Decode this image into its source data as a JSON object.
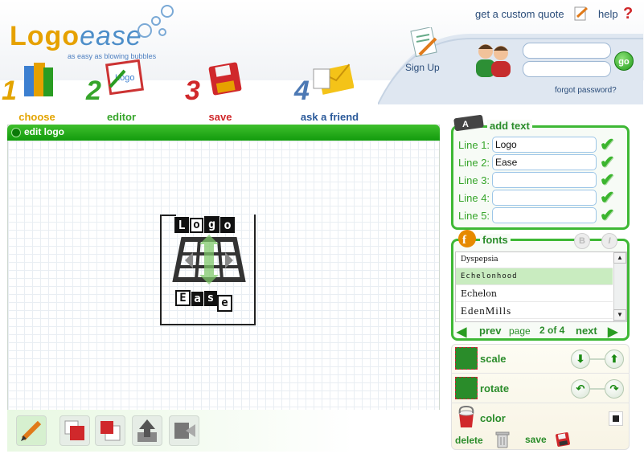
{
  "brand": {
    "logo_part1": "Logo",
    "logo_part2": "ease",
    "tagline": "as easy as blowing bubbles"
  },
  "top_links": {
    "custom_quote": "get a custom quote",
    "help": "help",
    "help_icon": "?"
  },
  "account": {
    "signup_label": "Sign Up",
    "username_value": "",
    "password_value": "",
    "go_label": "go",
    "forgot_label": "forgot password?"
  },
  "steps": [
    {
      "number": "1",
      "label": "choose",
      "icon": "books-icon"
    },
    {
      "number": "2",
      "label": "editor",
      "icon": "editor-icon"
    },
    {
      "number": "3",
      "label": "save",
      "icon": "floppy-icon"
    },
    {
      "number": "4",
      "label": "ask a friend",
      "icon": "envelope-icon"
    }
  ],
  "edit_panel": {
    "title": "edit logo",
    "logo_line1": [
      "L",
      "o",
      "g",
      "o"
    ],
    "logo_line2": [
      "E",
      "a",
      "s",
      "e"
    ]
  },
  "text_panel": {
    "title": "add text",
    "lines": [
      {
        "label": "Line 1:",
        "value": "Logo"
      },
      {
        "label": "Line 2:",
        "value": "Ease"
      },
      {
        "label": "Line 3:",
        "value": ""
      },
      {
        "label": "Line 4:",
        "value": ""
      },
      {
        "label": "Line 5:",
        "value": ""
      }
    ]
  },
  "fonts_panel": {
    "title": "fonts",
    "bold_label": "B",
    "italic_label": "I",
    "items": [
      "Dyspepsia",
      "Echelonhood",
      "Echelon",
      "EdenMills"
    ],
    "selected_index": 1,
    "prev_label": "prev",
    "page_label": "page",
    "page_count": "2 of 4",
    "next_label": "next"
  },
  "props_panel": {
    "scale_label": "scale",
    "rotate_label": "rotate",
    "color_label": "color",
    "color_value": "#222222",
    "delete_label": "delete",
    "save_label": "save"
  },
  "colors": {
    "accent_green": "#2a8c2a",
    "bar_green": "#129b0d",
    "link_blue": "#2b4d7a"
  }
}
